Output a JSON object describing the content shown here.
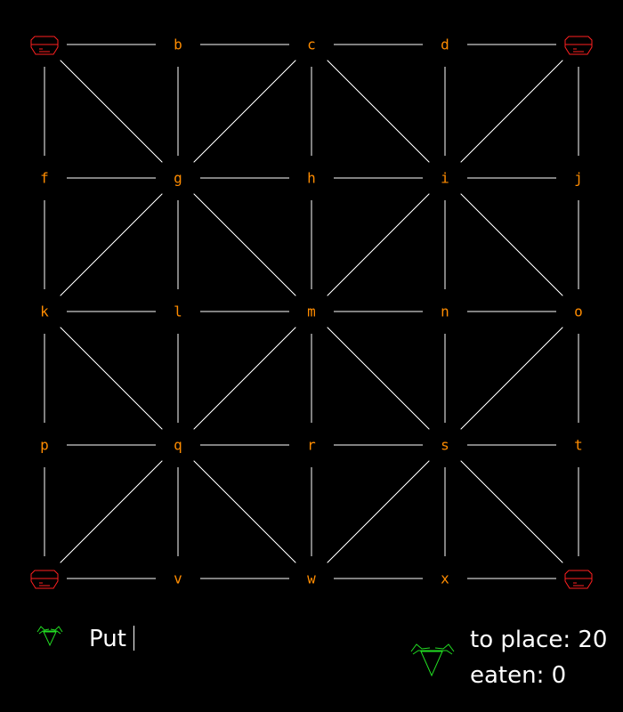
{
  "colors": {
    "background": "#000000",
    "line": "#ffffff",
    "label": "#ff8c00",
    "tiger": "#ff2020",
    "goat": "#22dd22",
    "text": "#ffffff"
  },
  "board": {
    "rows": [
      [
        "tiger",
        "b",
        "c",
        "d",
        "tiger"
      ],
      [
        "f",
        "g",
        "h",
        "i",
        "j"
      ],
      [
        "k",
        "l",
        "m",
        "n",
        "o"
      ],
      [
        "p",
        "q",
        "r",
        "s",
        "t"
      ],
      [
        "tiger",
        "v",
        "w",
        "x",
        "tiger"
      ]
    ],
    "piece_icon": "tiger-icon"
  },
  "status": {
    "turn_icon": "goat-icon",
    "prompt": "Put",
    "reserve_icon": "goat-icon",
    "to_place_label": "to place: 20",
    "eaten_label": "eaten: 0"
  }
}
